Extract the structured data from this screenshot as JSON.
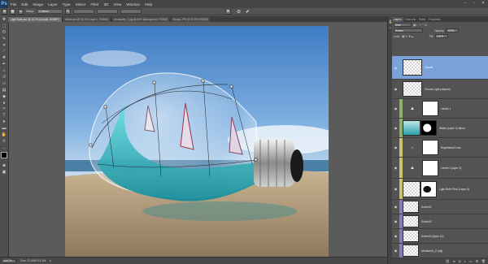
{
  "app": {
    "logo": "Ps"
  },
  "menu": [
    "File",
    "Edit",
    "Image",
    "Layer",
    "Type",
    "Select",
    "Filter",
    "3D",
    "View",
    "Window",
    "Help"
  ],
  "window_controls": [
    "–",
    "▫",
    "✕"
  ],
  "options": {
    "warp_label": "Warp:",
    "warp_value": "Custom",
    "cancel_icon": "⊘",
    "commit_icon": "✔"
  },
  "tabs": [
    {
      "label": "Light Bulb.psd @ 16.7% (Clouds, RGB/8*)",
      "active": true
    },
    {
      "label": "Water.psd @ 33.3% (Layer 1, RGB/8)",
      "active": false
    },
    {
      "label": "windsurfer_4.jpg @ 50% (Background, RGB/8)",
      "active": false
    },
    {
      "label": "Beach.JPG @ 33.3% (RGB/8)",
      "active": false
    }
  ],
  "status": {
    "zoom": "16.67%",
    "doc": "Doc: 22.4M/131.1M",
    "arrow": "▸"
  },
  "panels": {
    "tabs": [
      "Layers",
      "Channels",
      "Paths",
      "Properties"
    ],
    "active_tab": "Layers",
    "kind": "Kind",
    "blend": "Screen",
    "opacity_label": "Opacity:",
    "opacity_value": "100%",
    "lock_label": "Lock:",
    "fill_label": "Fill:",
    "fill_value": "100%",
    "layers": [
      {
        "name": "Clouds",
        "label_color": "none",
        "selected": true
      },
      {
        "name": "Clouds Light (objects)",
        "label_color": "none",
        "selected": false
      },
      {
        "name": "Levels 1",
        "label_color": "#8fb06a",
        "selected": false
      },
      {
        "name": "Water (Layer 2) blend",
        "label_color": "#8fb06a",
        "selected": false
      },
      {
        "name": "Brightness/Contr...",
        "label_color": "#c9c46a",
        "selected": false
      },
      {
        "name": "Levels 2 (layer 3)",
        "label_color": "#c9c46a",
        "selected": false
      },
      {
        "name": "Light Bulb Pivot (Layer 4)",
        "label_color": "#c9c46a",
        "selected": false
      },
      {
        "name": "Surfer01",
        "label_color": "#8a7ab8",
        "selected": false
      },
      {
        "name": "Surfer02",
        "label_color": "#8a7ab8",
        "selected": false
      },
      {
        "name": "Surfer03 (layer 10)",
        "label_color": "#8a7ab8",
        "selected": false
      },
      {
        "name": "windsurfer_2 (obj)",
        "label_color": "#8a7ab8",
        "selected": false
      }
    ]
  }
}
